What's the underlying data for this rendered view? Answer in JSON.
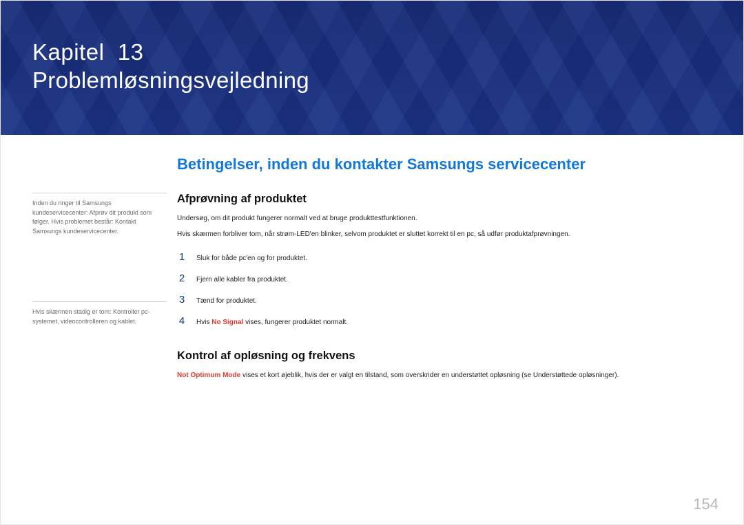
{
  "banner": {
    "chapter_label_prefix": "Kapitel",
    "chapter_number": "13",
    "chapter_title": "Problemløsningsvejledning"
  },
  "sidebar": {
    "note1": "Inden du ringer til Samsungs kundeservicecenter: Afprøv dit produkt som følger. Hvis problemet består: Kontakt Samsungs kundeservicecenter.",
    "note2": "Hvis skærmen stadig er tom: Kontroller pc-systemet, videocontrolleren og kablet."
  },
  "main": {
    "h1": "Betingelser, inden du kontakter Samsungs servicecenter",
    "section1": {
      "heading": "Afprøvning af produktet",
      "p1": "Undersøg, om dit produkt fungerer normalt ved at bruge produkttestfunktionen.",
      "p2": "Hvis skærmen forbliver tom, når strøm-LED'en blinker, selvom produktet er sluttet korrekt til en pc, så udfør produktafprøvningen.",
      "steps": [
        "Sluk for både pc'en og for produktet.",
        "Fjern alle kabler fra produktet.",
        "Tænd for produktet.",
        {
          "prefix": "Hvis ",
          "highlight": "No Signal",
          "suffix": " vises, fungerer produktet normalt."
        }
      ]
    },
    "section2": {
      "heading": "Kontrol af opløsning og frekvens",
      "p_prefix": "Not Optimum Mode",
      "p_rest": " vises et kort øjeblik, hvis der er valgt en tilstand, som overskrider en understøttet opløsning (se Understøttede opløsninger)."
    }
  },
  "page_number": "154"
}
